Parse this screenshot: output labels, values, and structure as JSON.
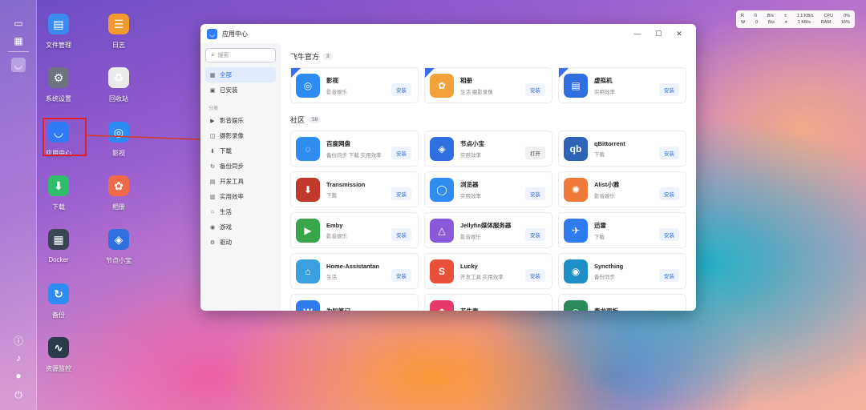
{
  "system_monitor": {
    "rows": [
      {
        "a": "R",
        "b": "0",
        "c": "B/s",
        "d": "±",
        "e": "1.1 KB/s",
        "f": "CPU",
        "g": "0%"
      },
      {
        "a": "W",
        "b": "0",
        "c": "B/s",
        "d": "±",
        "e": "1 KB/s",
        "f": "RAM",
        "g": "15%"
      }
    ]
  },
  "desktop_icons": [
    {
      "label": "文件管理",
      "glyph": "▤",
      "color": "#3b8cf0"
    },
    {
      "label": "日志",
      "glyph": "☰",
      "color": "#f29a2e"
    },
    {
      "label": "系统设置",
      "glyph": "⚙",
      "color": "#6e7480"
    },
    {
      "label": "回收站",
      "glyph": "♻",
      "color": "#eaeaea"
    },
    {
      "label": "应用中心",
      "glyph": "◡",
      "color": "#2f7cf6"
    },
    {
      "label": "影视",
      "glyph": "◎",
      "color": "#2c8cf4"
    },
    {
      "label": "下载",
      "glyph": "⬇",
      "color": "#2fbf6a"
    },
    {
      "label": "相册",
      "glyph": "✿",
      "color": "#f06a4a"
    },
    {
      "label": "Docker",
      "glyph": "▦",
      "color": "#3b4556"
    },
    {
      "label": "节点小宝",
      "glyph": "◈",
      "color": "#2f6fe0"
    },
    {
      "label": "备份",
      "glyph": "↻",
      "color": "#2d8cf0"
    },
    {
      "label": "资源监控",
      "glyph": "∿",
      "color": "#2b3b4c"
    }
  ],
  "window": {
    "title": "应用中心",
    "controls": {
      "minimize": "—",
      "maximize": "☐",
      "close": "✕"
    },
    "search_placeholder": "搜索",
    "nav_top": [
      {
        "label": "全部",
        "icon": "▦",
        "active": true
      },
      {
        "label": "已安装",
        "icon": "▣",
        "active": false
      }
    ],
    "nav_section": "分类",
    "nav_categories": [
      {
        "label": "影音娱乐",
        "icon": "▶"
      },
      {
        "label": "摄影录像",
        "icon": "◫"
      },
      {
        "label": "下载",
        "icon": "⬇"
      },
      {
        "label": "备份同步",
        "icon": "↻"
      },
      {
        "label": "开发工具",
        "icon": "▤"
      },
      {
        "label": "实用效率",
        "icon": "▥"
      },
      {
        "label": "生活",
        "icon": "⌂"
      },
      {
        "label": "游戏",
        "icon": "◉"
      },
      {
        "label": "驱动",
        "icon": "⚙"
      }
    ],
    "official": {
      "title": "飞牛官方",
      "count": "3",
      "apps": [
        {
          "name": "影视",
          "desc": "影音娱乐",
          "btn": "安装",
          "color": "#2c8cf4",
          "glyph": "◎"
        },
        {
          "name": "相册",
          "desc": "生活 摄影录像",
          "btn": "安装",
          "color": "#f3a23a",
          "glyph": "✿"
        },
        {
          "name": "虚拟机",
          "desc": "实用效率",
          "btn": "安装",
          "color": "#2f6fe0",
          "glyph": "▤"
        }
      ]
    },
    "community": {
      "title": "社区",
      "count": "59",
      "apps": [
        {
          "name": "百度网盘",
          "desc": "备份同步 下载 实用效率",
          "btn": "安装",
          "color": "#2f8cf0",
          "glyph": "◌"
        },
        {
          "name": "节点小宝",
          "desc": "实用效率",
          "btn": "打开",
          "color": "#2f6fe0",
          "glyph": "◈"
        },
        {
          "name": "qBittorrent",
          "desc": "下载",
          "btn": "安装",
          "color": "#2f63b8",
          "glyph": "qb"
        },
        {
          "name": "Transmission",
          "desc": "下载",
          "btn": "安装",
          "color": "#c0392b",
          "glyph": "⬇"
        },
        {
          "name": "浏览器",
          "desc": "实用效率",
          "btn": "安装",
          "color": "#2f8cf0",
          "glyph": "◯"
        },
        {
          "name": "Alist小雅",
          "desc": "影音娱乐",
          "btn": "安装",
          "color": "#f07a3a",
          "glyph": "✺"
        },
        {
          "name": "Emby",
          "desc": "影音娱乐",
          "btn": "安装",
          "color": "#3aa64a",
          "glyph": "▶"
        },
        {
          "name": "Jellyfin媒体服务器",
          "desc": "影音娱乐",
          "btn": "安装",
          "color": "#8a5ad8",
          "glyph": "△"
        },
        {
          "name": "迅雷",
          "desc": "下载",
          "btn": "安装",
          "color": "#2f7cf0",
          "glyph": "✈"
        },
        {
          "name": "Home-Assistantan",
          "desc": "生活",
          "btn": "安装",
          "color": "#3aa0e0",
          "glyph": "⌂"
        },
        {
          "name": "Lucky",
          "desc": "开发工具 实用效率",
          "btn": "安装",
          "color": "#e8503a",
          "glyph": "S"
        },
        {
          "name": "Syncthing",
          "desc": "备份同步",
          "btn": "安装",
          "color": "#1f8fc8",
          "glyph": "◉"
        },
        {
          "name": "为知笔记",
          "desc": "",
          "btn": "",
          "color": "#2f7cf0",
          "glyph": "W"
        },
        {
          "name": "花生壳",
          "desc": "",
          "btn": "",
          "color": "#e83a6a",
          "glyph": "✿"
        },
        {
          "name": "青龙面板",
          "desc": "",
          "btn": "",
          "color": "#2a8a5a",
          "glyph": "◎"
        }
      ]
    }
  }
}
